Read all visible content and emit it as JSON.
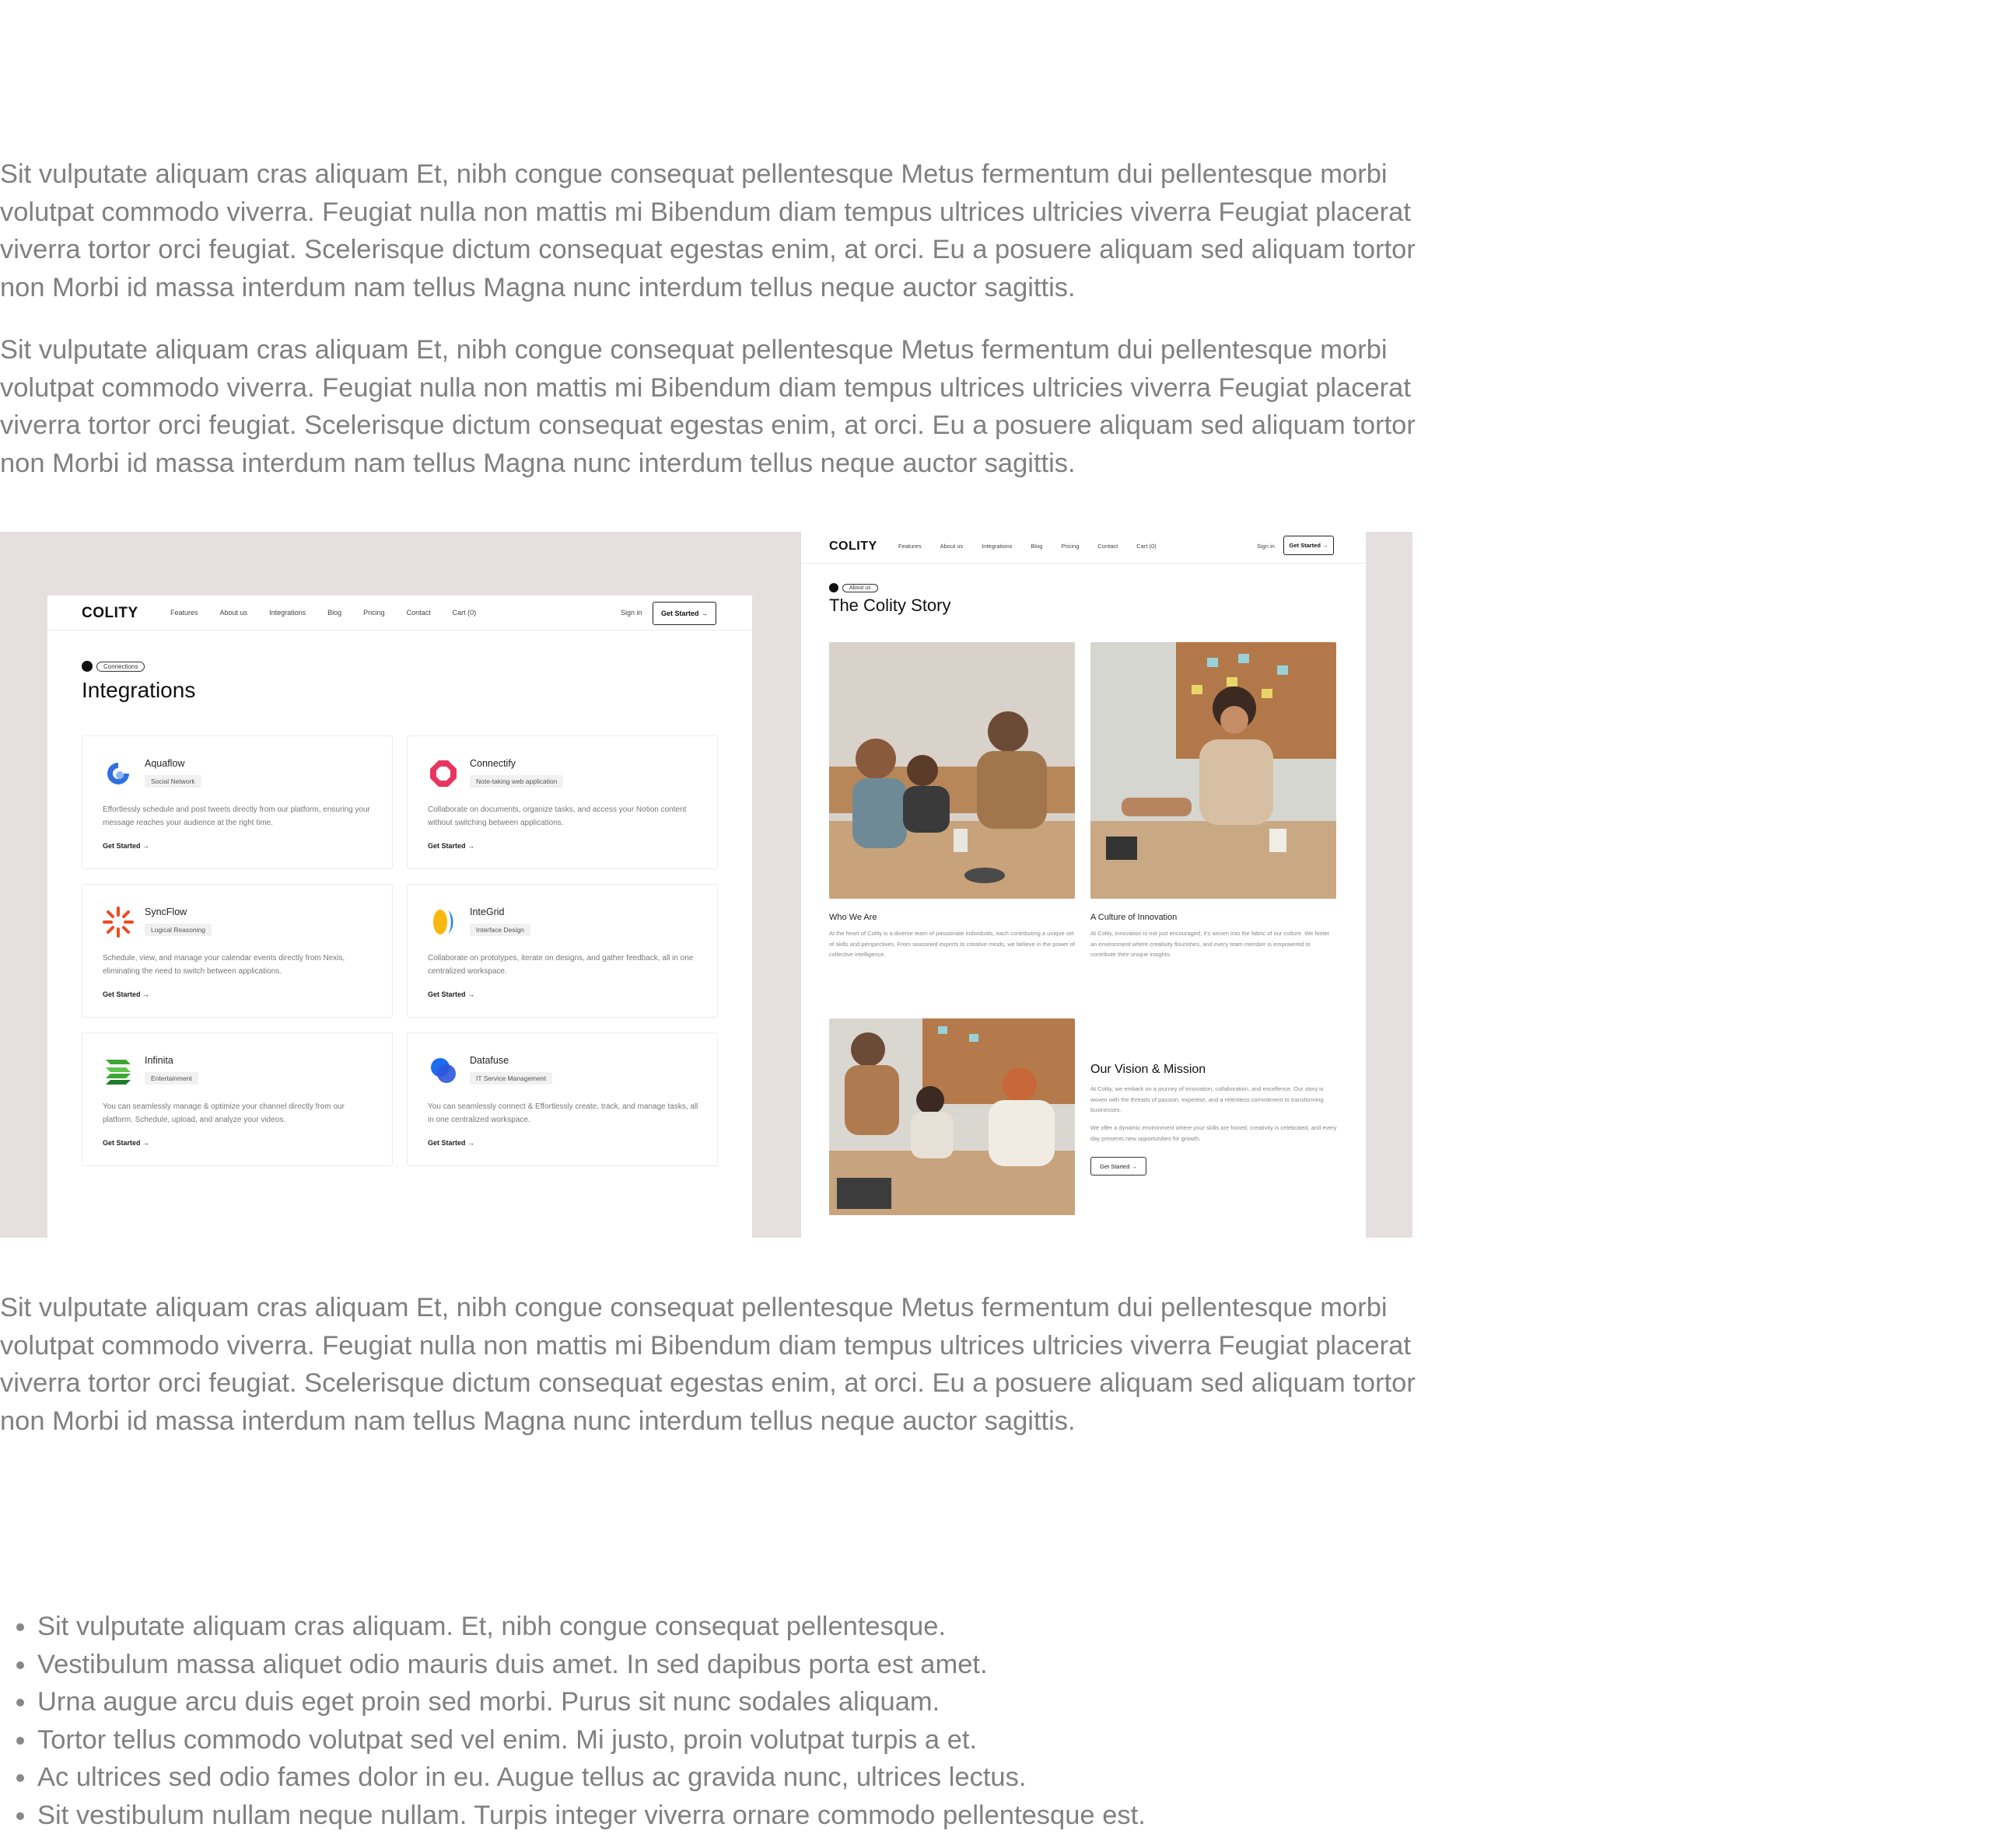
{
  "paragraphs": [
    "Sit vulputate aliquam cras aliquam Et, nibh congue consequat pellentesque Metus fermentum dui pellentesque morbi volutpat commodo viverra. Feugiat nulla non mattis mi Bibendum diam tempus ultrices ultricies viverra Feugiat placerat viverra tortor orci feugiat. Scelerisque dictum consequat egestas enim, at orci. Eu a posuere aliquam sed aliquam tortor non Morbi id massa interdum nam tellus Magna nunc interdum tellus neque auctor sagittis.",
    "Sit vulputate aliquam cras aliquam Et, nibh congue consequat pellentesque Metus fermentum dui pellentesque morbi volutpat commodo viverra. Feugiat nulla non mattis mi Bibendum diam tempus ultrices ultricies viverra Feugiat placerat viverra tortor orci feugiat. Scelerisque dictum consequat egestas enim, at orci. Eu a posuere aliquam sed aliquam tortor non Morbi id massa interdum nam tellus Magna nunc interdum tellus neque auctor sagittis.",
    "Sit vulputate aliquam cras aliquam Et, nibh congue consequat pellentesque Metus fermentum dui pellentesque morbi volutpat commodo viverra. Feugiat nulla non mattis mi Bibendum diam tempus ultrices ultricies viverra Feugiat placerat viverra tortor orci feugiat. Scelerisque dictum consequat egestas enim, at orci. Eu a posuere aliquam sed aliquam tortor non Morbi id massa interdum nam tellus Magna nunc interdum tellus neque auctor sagittis."
  ],
  "nav": {
    "logo": "COLITY",
    "links": [
      "Features",
      "About us",
      "Integrations",
      "Blog",
      "Pricing",
      "Contact",
      "Cart (0)"
    ],
    "signin": "Sign in",
    "cta": "Get Started →"
  },
  "integrations": {
    "tag": "Connections",
    "title": "Integrations",
    "cards": [
      {
        "name": "Aquaflow",
        "badge": "Social Network",
        "desc": "Effortlessly schedule and post tweets directly from our platform, ensuring your message reaches your audience at the right time.",
        "link": "Get Started →"
      },
      {
        "name": "Connectify",
        "badge": "Note-taking web application",
        "desc": "Collaborate on documents, organize tasks, and access your Notion content without switching between applications.",
        "link": "Get Started →"
      },
      {
        "name": "SyncFlow",
        "badge": "Logical Reasoning",
        "desc": "Schedule, view, and manage your calendar events directly from Nexis, eliminating the need to switch between applications.",
        "link": "Get Started →"
      },
      {
        "name": "InteGrid",
        "badge": "Interface Design",
        "desc": "Collaborate on prototypes, iterate on designs, and gather feedback, all in one centralized workspace.",
        "link": "Get Started →"
      },
      {
        "name": "Infinita",
        "badge": "Entertainment",
        "desc": "You can seamlessly manage & optimize your channel directly from our platform. Schedule, upload, and analyze your videos.",
        "link": "Get Started →"
      },
      {
        "name": "Datafuse",
        "badge": "IT Service Management",
        "desc": "You can seamlessly connect & Effortlessly create, track, and manage tasks, all in one centralized workspace.",
        "link": "Get Started →"
      }
    ]
  },
  "story": {
    "tag": "About us",
    "title": "The Colity Story",
    "cols": [
      {
        "title": "Who We Are",
        "desc": "At the heart of Colity is a diverse team of passionate individuals, each contributing a unique set of skills and perspectives. From seasoned experts to creative minds, we believe in the power of collective intelligence."
      },
      {
        "title": "A Culture of Innovation",
        "desc": "At Colity, innovation is not just encouraged; it's woven into the fabric of our culture. We foster an environment where creativity flourishes, and every team member is empowered to contribute their unique insights."
      }
    ],
    "vision_title": "Our Vision & Mission",
    "vision_p1": "At Colity, we embark on a journey of innovation, collaboration, and excellence. Our story is woven with the threads of passion, expertise, and a relentless commitment to transforming businesses.",
    "vision_p2": "We offer a dynamic environment where your skills are honed, creativity is celebrated, and every day presents new opportunities for growth.",
    "vision_cta": "Get Started →"
  },
  "bullets": [
    "Sit vulputate aliquam cras aliquam. Et, nibh congue consequat pellentesque.",
    "Vestibulum massa aliquet odio mauris duis amet. In sed dapibus porta est amet.",
    "Urna augue arcu duis eget proin sed morbi. Purus sit nunc sodales aliquam.",
    "Tortor tellus commodo volutpat sed vel enim. Mi justo, proin volutpat turpis a et.",
    "Ac ultrices sed odio fames dolor in eu. Augue tellus ac gravida nunc, ultrices lectus.",
    "Sit vestibulum nullam neque nullam. Turpis integer viverra ornare commodo pellentesque est."
  ],
  "colors": {
    "panel_bg": "#e6dfe0",
    "text_gray": "#808080"
  },
  "icons": [
    "aquaflow-logo-icon",
    "connectify-logo-icon",
    "syncflow-logo-icon",
    "integrid-logo-icon",
    "infinita-logo-icon",
    "datafuse-logo-icon"
  ]
}
